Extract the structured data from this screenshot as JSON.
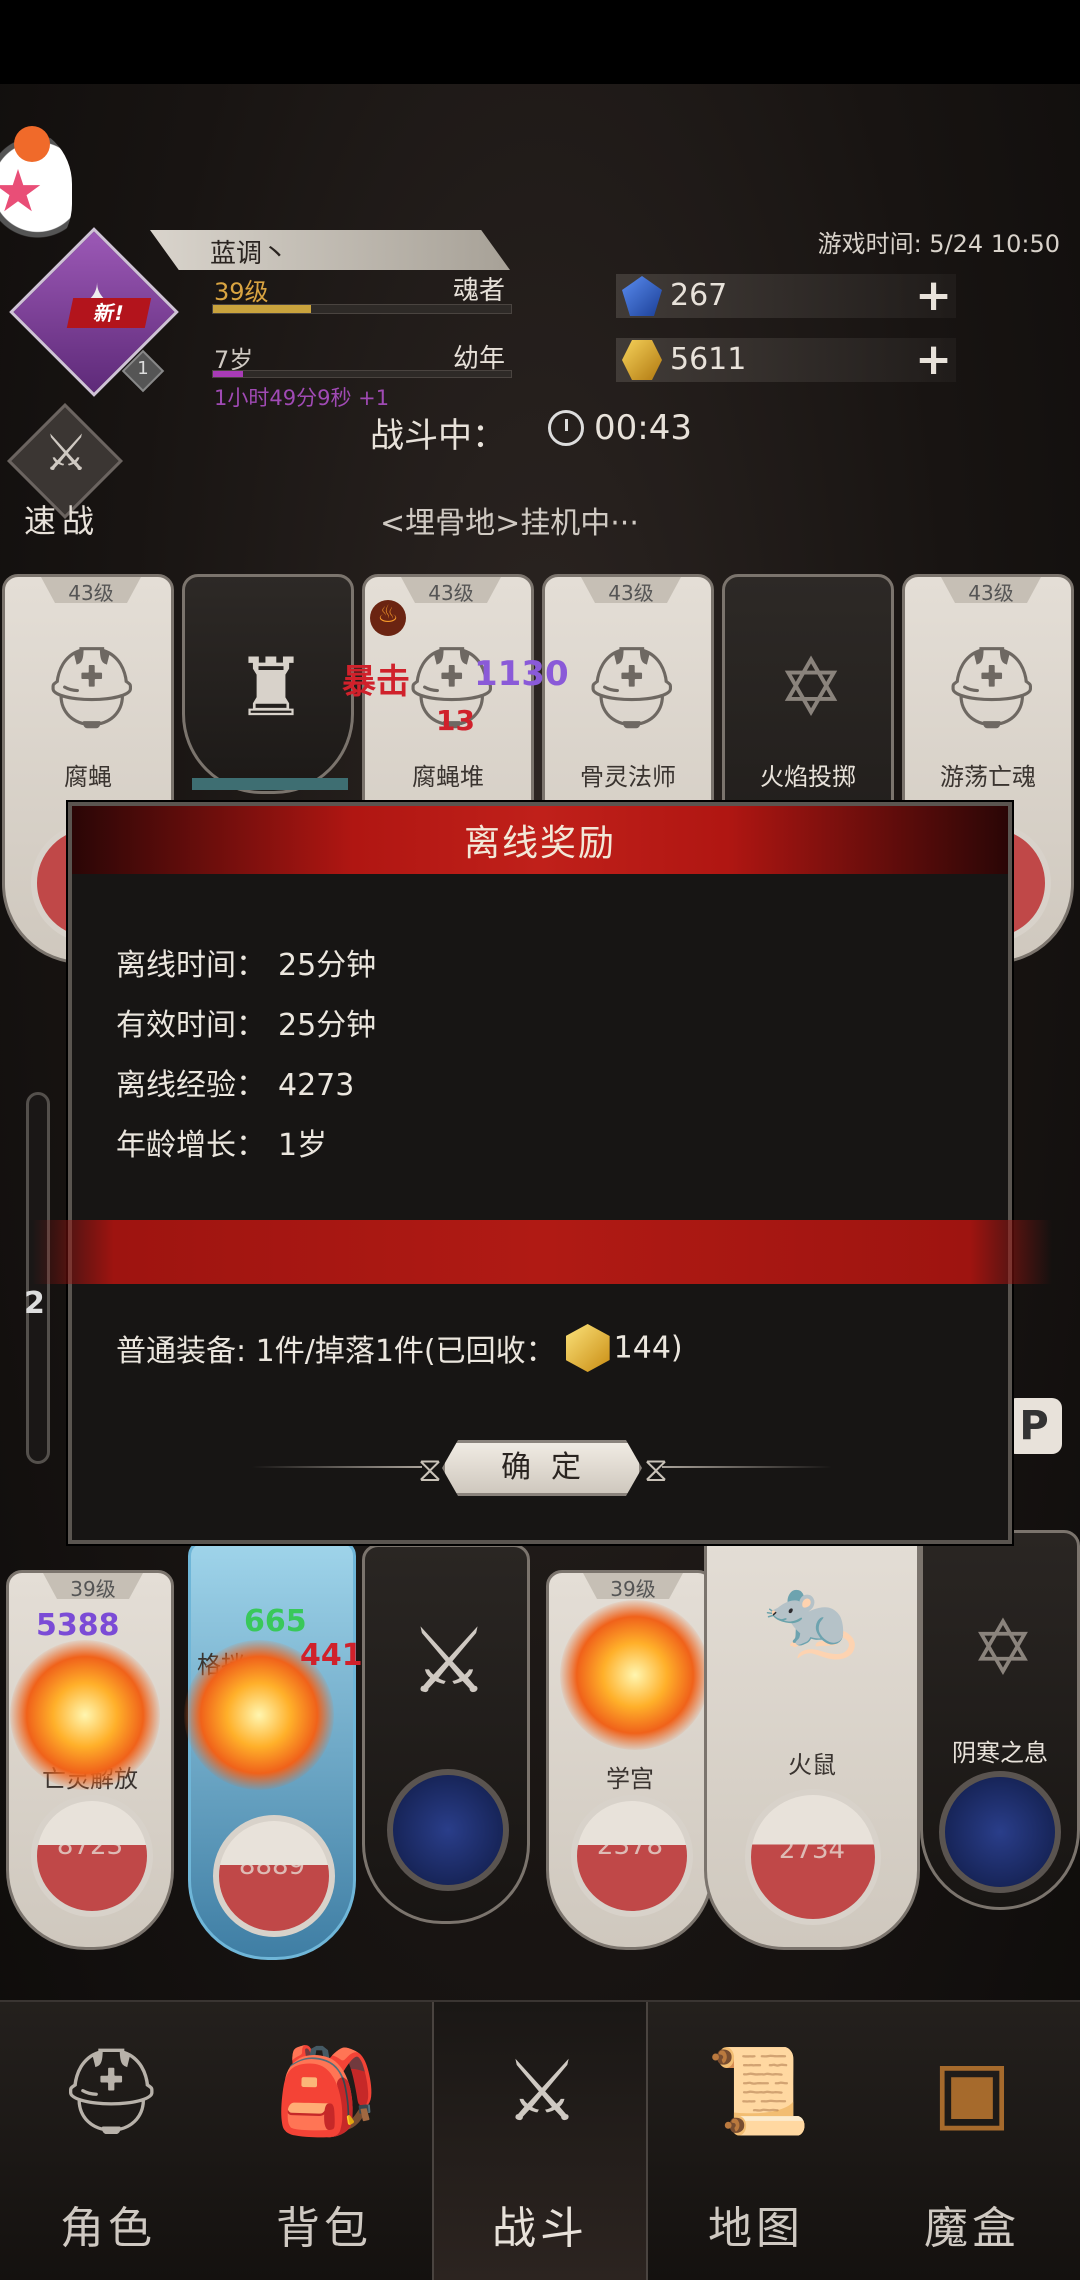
{
  "header": {
    "player_name": "蓝调丶",
    "level_label": "39级",
    "class_label": "魂者",
    "xp_fraction": 0.33,
    "age_label": "7岁",
    "age_stage": "幼年",
    "age_fraction": 0.1,
    "age_timer": "1小时49分9秒 +1",
    "new_badge": "新!",
    "class_badge_level": "1",
    "game_time": "游戏时间: 5/24 10:50",
    "crystals": "267",
    "gold": "5611",
    "plus": "+"
  },
  "battle": {
    "status": "战斗中：",
    "timer": "00:43",
    "quick_fight": "速战",
    "location": "<埋骨地>挂机中···",
    "crit_label": "暴击",
    "crit_damage": "1130",
    "burn_damage": "13"
  },
  "enemies": [
    {
      "level": "43级",
      "name": "腐蝇"
    },
    {
      "level": "",
      "name": ""
    },
    {
      "level": "43级",
      "name": "腐蝇堆"
    },
    {
      "level": "43级",
      "name": "骨灵法师"
    },
    {
      "level": "",
      "name": "火焰投掷"
    },
    {
      "level": "43级",
      "name": "游荡亡魂"
    }
  ],
  "side_gauge": "2",
  "players": [
    {
      "level": "39级",
      "name": "亡灵解放",
      "hp": "8723",
      "float": "5388"
    },
    {
      "level": "",
      "name": "格挡",
      "hp": "8889",
      "float_heal": "665",
      "float_dmg": "441"
    },
    {
      "level": "",
      "name": "",
      "hp": ""
    },
    {
      "level": "39级",
      "name": "学宫",
      "hp": "2378"
    },
    {
      "level": "",
      "name": "火鼠",
      "hp": "2734"
    },
    {
      "level": "",
      "name": "阴寒之息",
      "hp": ""
    }
  ],
  "modal": {
    "title": "离线奖励",
    "rows": [
      {
        "label": "离线时间：",
        "value": "25分钟"
      },
      {
        "label": "有效时间：",
        "value": "25分钟"
      },
      {
        "label": "离线经验：",
        "value": "4273"
      },
      {
        "label": "年龄增长：",
        "value": "1岁"
      }
    ],
    "equipment_prefix": "普通装备: 1件/掉落1件(已回收：",
    "equipment_gold": "144)",
    "confirm": "确定"
  },
  "nav": [
    {
      "label": "角色",
      "icon": "helmet-icon"
    },
    {
      "label": "背包",
      "icon": "backpack-icon"
    },
    {
      "label": "战斗",
      "icon": "sword-shield-icon"
    },
    {
      "label": "地图",
      "icon": "scroll-map-icon"
    },
    {
      "label": "魔盒",
      "icon": "magic-box-icon"
    }
  ],
  "colors": {
    "accent_red": "#b01612",
    "gold": "#d9a441",
    "purple": "#a04ab4"
  }
}
